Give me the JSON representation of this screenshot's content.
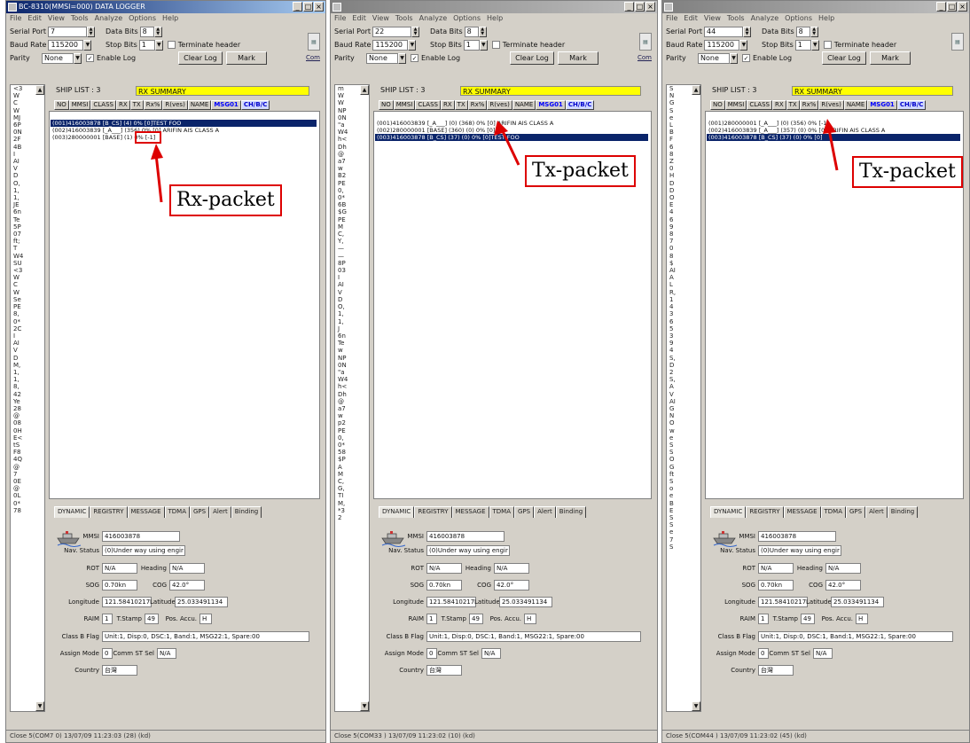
{
  "windows": [
    {
      "title": "BC-8310(MMSI=000) DATA LOGGER",
      "menu": [
        "File",
        "Edit",
        "View",
        "Tools",
        "Analyze",
        "Options",
        "Help"
      ],
      "serial_port_label": "Serial Port",
      "serial_port": "7",
      "data_bits_label": "Data Bits",
      "data_bits": "8",
      "baud_rate_label": "Baud Rate",
      "baud_rate": "115200",
      "stop_bits_label": "Stop Bits",
      "stop_bits": "1",
      "terminate_label": "Terminate header",
      "parity_label": "Parity",
      "parity": "None",
      "enable_log_label": "Enable Log",
      "clear_log": "Clear Log",
      "mark": "Mark",
      "com_label": "Com",
      "ship_list": "SHIP LIST : 3",
      "rx_summary": "RX SUMMARY",
      "columns": [
        "NO",
        "MMSI",
        "CLASS",
        "RX",
        "TX",
        "Rx%",
        "R(ves)",
        "NAME",
        "MSG01",
        "CH/B/C"
      ],
      "rows": [
        {
          "text": "(001)416003878 [B_CS]  (4)     0%  [0]TEST FOO",
          "selected": true
        },
        {
          "text": "(002)416003839 [_A___] (356)   0%  [0] ARIFIN AIS CLASS A",
          "selected": false
        },
        {
          "text": "(003)280000001 [BASE]  (1)     0%  [-1]",
          "selected": false
        }
      ],
      "side_items": [
        "<3",
        "W",
        "C",
        "W",
        "MJ",
        "6P",
        "0N",
        "2F",
        "4B",
        "I",
        "AI",
        "V",
        "D",
        "O,",
        "1,",
        "1,",
        "JE",
        "6n",
        "Te",
        "5P",
        "07",
        "ft;",
        "T",
        "W4",
        "SU",
        "<3",
        "W",
        "C",
        "W",
        "Se",
        "PE",
        "8,",
        "0*",
        "2C",
        "I",
        "AI",
        "V",
        "D",
        "M,",
        "1,",
        "1,",
        "8,",
        "42",
        "Ye",
        "28",
        "@",
        "08",
        "0H",
        "E<",
        "tS",
        "F8",
        "4Q",
        "@",
        "7",
        "0E",
        "@",
        "0L",
        "0*",
        "78"
      ],
      "tabs": [
        "DYNAMIC",
        "REGISTRY",
        "MESSAGE",
        "TDMA",
        "GPS",
        "Alert",
        "Binding"
      ],
      "status": "Close 5(COM7 0) 13/07/09 11:23:03 (28) (kd)",
      "offset": "Rx-packet"
    },
    {
      "title": "",
      "menu": [
        "File",
        "Edit",
        "View",
        "Tools",
        "Analyze",
        "Options",
        "Help"
      ],
      "serial_port_label": "Serial Port",
      "serial_port": "22",
      "data_bits_label": "Data Bits",
      "data_bits": "8",
      "baud_rate_label": "Baud Rate",
      "baud_rate": "115200",
      "stop_bits_label": "Stop Bits",
      "stop_bits": "1",
      "terminate_label": "Terminate header",
      "parity_label": "Parity",
      "parity": "None",
      "enable_log_label": "Enable Log",
      "clear_log": "Clear Log",
      "mark": "Mark",
      "com_label": "Com",
      "ship_list": "SHIP LIST : 3",
      "rx_summary": "RX SUMMARY",
      "columns": [
        "NO",
        "MMSI",
        "CLASS",
        "RX",
        "TX",
        "Rx%",
        "R(ves)",
        "NAME",
        "MSG01",
        "CH/B/C"
      ],
      "rows": [
        {
          "text": "(001)416003839 [_A___] (0) (368)   0%  [0] ARIFIN AIS CLASS A",
          "selected": false
        },
        {
          "text": "(002)280000001 [BASE] (360) (0)    0%  [0]",
          "selected": false
        },
        {
          "text": "(003)416003878 [B_CS] (37)  (0)    0%  [0]TEST FOO",
          "selected": true
        }
      ],
      "side_items": [
        "m",
        "W",
        "W",
        "NP",
        "0N",
        "\"a",
        "W4",
        "h<",
        "Dh",
        "@",
        "a7",
        "w",
        "B2",
        "PE",
        "0,",
        "0*",
        "6B",
        "$G",
        "PE",
        "M",
        "C,",
        "Y,",
        "—",
        "—",
        "8P",
        "03",
        "I",
        "AI",
        "V",
        "D",
        "O,",
        "1,",
        "1,",
        "J",
        "6n",
        "Te",
        "w",
        "NP",
        "0N",
        "\"a",
        "W4",
        "h<",
        "Dh",
        "@",
        "a7",
        "w",
        "p2",
        "PE",
        "0,",
        "0*",
        "58",
        "$P",
        "A",
        "M",
        "C,",
        "G,",
        "TI",
        "M,",
        "*3",
        "2"
      ],
      "tabs": [
        "DYNAMIC",
        "REGISTRY",
        "MESSAGE",
        "TDMA",
        "GPS",
        "Alert",
        "Binding"
      ],
      "status": "Close 5(COM33 ) 13/07/09 11:23:02 (10) (kd)",
      "offset": "Tx-packet"
    },
    {
      "title": "",
      "menu": [
        "File",
        "Edit",
        "View",
        "Tools",
        "Analyze",
        "Options",
        "Help"
      ],
      "serial_port_label": "Serial Port",
      "serial_port": "44",
      "data_bits_label": "Data Bits",
      "data_bits": "8",
      "baud_rate_label": "Baud Rate",
      "baud_rate": "115200",
      "stop_bits_label": "Stop Bits",
      "stop_bits": "1",
      "terminate_label": "Terminate header",
      "parity_label": "Parity",
      "parity": "None",
      "enable_log_label": "Enable Log",
      "clear_log": "Clear Log",
      "mark": "Mark",
      "com_label": "",
      "ship_list": "SHIP LIST : 3",
      "rx_summary": "RX SUMMARY",
      "columns": [
        "NO",
        "MMSI",
        "CLASS",
        "RX",
        "TX",
        "Rx%",
        "R(ves)",
        "NAME",
        "MSG01",
        "CH/B/C"
      ],
      "rows": [
        {
          "text": "(001)280000001 [_A___] (0) (356)   0%  [-1]",
          "selected": false
        },
        {
          "text": "(002)416003839 [_A___] (357) (0)   0%  [0] ARIFIN AIS CLASS A",
          "selected": false
        },
        {
          "text": "(003)416003878 [B_CS] (37) (0)     0%  [0]",
          "selected": true
        }
      ],
      "side_items": [
        "S",
        "N",
        "G",
        "S",
        "e",
        "L",
        "B",
        "F",
        "6",
        "8",
        "Z",
        "0",
        "H",
        "D",
        "D",
        "O",
        "E",
        "4",
        "6",
        "9",
        "8",
        "7",
        "0",
        "8",
        "$",
        "AI",
        "A",
        "L",
        "R,",
        "1",
        "4",
        "3",
        "6",
        "5",
        "3",
        "9",
        "4",
        "S,",
        "D",
        "2",
        "S,",
        "A",
        "V",
        "AI",
        "G",
        "N",
        "O",
        "w",
        "e",
        "S",
        "S",
        "O",
        "G",
        "ft",
        "S",
        "o",
        "e",
        "B",
        "E",
        "S",
        "S",
        "e",
        "7",
        "S"
      ],
      "tabs": [
        "DYNAMIC",
        "REGISTRY",
        "MESSAGE",
        "TDMA",
        "GPS",
        "Alert",
        "Binding"
      ],
      "status": "Close 5(COM44 ) 13/07/09 11:23:02 (45) (kd)",
      "offset": "Tx-packet"
    }
  ],
  "dynamic": {
    "mmsi_label": "MMSI",
    "mmsi": "416003878",
    "nav_status_label": "Nav. Status",
    "nav_status": "(0)Under way using engir",
    "rot_label": "ROT",
    "rot": "N/A",
    "heading_label": "Heading",
    "heading": "N/A",
    "sog_label": "SOG",
    "sog": "0.70kn",
    "cog_label": "COG",
    "cog": "42.0°",
    "longitude_label": "Longitude",
    "longitude": "121.58410217",
    "latitude_label": "Latitude",
    "latitude": "25.033491134",
    "raim_label": "RAIM",
    "raim": "1",
    "tstamp_label": "T.Stamp",
    "tstamp": "49",
    "pos_accu_label": "Pos. Accu.",
    "pos_accu": "H",
    "classb_label": "Class B Flag",
    "classb": "Unit:1, Disp:0, DSC:1, Band:1, MSG22:1, Spare:00",
    "assign_label": "Assign Mode",
    "assign": "0",
    "comm_label": "Comm ST Sel",
    "comm": "N/A",
    "country_label": "Country",
    "country": "台灣"
  },
  "annotations": {
    "rx": "Rx-packet",
    "tx1": "Tx-packet",
    "tx2": "Tx-packet"
  },
  "colors": {
    "annotation_red": "#dd0000",
    "selection_blue": "#0a246a",
    "rx_summary_yellow": "#ffff00",
    "header_blue": "#0000ff"
  }
}
